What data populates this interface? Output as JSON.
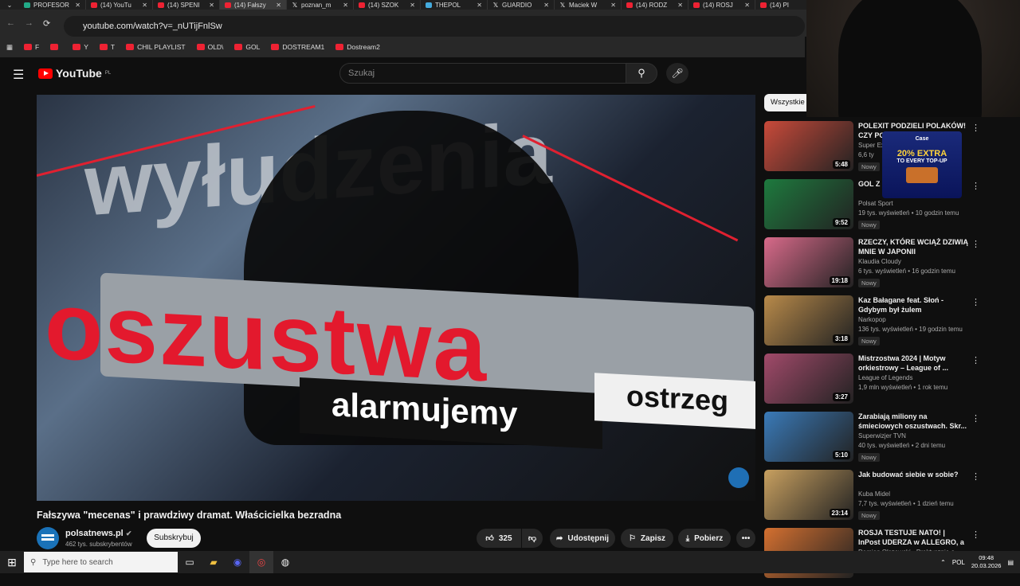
{
  "browser": {
    "tabs": [
      {
        "title": "PROFESOR",
        "icon": "green"
      },
      {
        "title": "(14) YouTu",
        "icon": "yt"
      },
      {
        "title": "(14) SPENI",
        "icon": "yt"
      },
      {
        "title": "(14) Fałszy",
        "icon": "yt",
        "active": true
      },
      {
        "title": "poznan_m",
        "icon": "x"
      },
      {
        "title": "(14) SZOK",
        "icon": "yt"
      },
      {
        "title": "THEPOL",
        "icon": "blue"
      },
      {
        "title": "GUARDIO",
        "icon": "x"
      },
      {
        "title": "Maciek W",
        "icon": "x"
      },
      {
        "title": "(14) RODZ",
        "icon": "yt"
      },
      {
        "title": "(14) ROSJ",
        "icon": "yt"
      },
      {
        "title": "(14) PI",
        "icon": "yt"
      }
    ],
    "url": "youtube.com/watch?v=_nUTijFnlSw",
    "bookmarks": [
      "F",
      "",
      "Y",
      "T",
      "CHIL PLAYLIST",
      "OLD\\",
      "GOL",
      "DOSTREAM1",
      "Dostream2"
    ]
  },
  "youtube": {
    "logo_text": "YouTube",
    "logo_region": "PL",
    "search_placeholder": "Szukaj",
    "chip_all": "Wszystkie"
  },
  "video": {
    "overlay_text_top": "wyłudzenia",
    "overlay_text_main": "oszustwa",
    "overlay_text_box1": "alarmujemy",
    "overlay_text_box2": "ostrzeg",
    "title": "Fałszywa \"mecenas\" i prawdziwy dramat. Właścicielka bezradna",
    "channel_name": "polsatnews.pl",
    "channel_subs": "462 tys. subskrybentów",
    "subscribe_label": "Subskrybuj",
    "likes": "325",
    "share_label": "Udostępnij",
    "save_label": "Zapisz",
    "download_label": "Pobierz"
  },
  "sidebar": {
    "videos": [
      {
        "title": "POLEXIT PODZIELI POLAKÓW! CZY PO",
        "channel": "Super Ex",
        "meta": "6,6 ty",
        "badge": "Nowy",
        "duration": "5:48",
        "thumb": "#c94a3a"
      },
      {
        "title": "GOL Z I MARZE",
        "channel": "Polsat Sport",
        "meta": "19 tys. wyświetleń • 10 godzin temu",
        "badge": "Nowy",
        "duration": "9:52",
        "thumb": "#1e7a3e"
      },
      {
        "title": "RZECZY, KTÓRE WCIĄŻ DZIWIĄ MNIE W JAPONII",
        "channel": "Klaudia Cloudy",
        "meta": "6 tys. wyświetleń • 16 godzin temu",
        "badge": "Nowy",
        "duration": "19:18",
        "thumb": "#d86a8a"
      },
      {
        "title": "Kaz Bałagane feat. Słoń - Gdybym był żulem",
        "channel": "Narkopop",
        "meta": "136 tys. wyświetleń • 19 godzin temu",
        "badge": "Nowy",
        "duration": "3:18",
        "thumb": "#b88a4a"
      },
      {
        "title": "Mistrzostwa 2024 | Motyw orkiestrowy – League of ...",
        "channel": "League of Legends",
        "meta": "1,9 mln wyświetleń • 1 rok temu",
        "badge": "",
        "duration": "3:27",
        "thumb": "#a14a6a"
      },
      {
        "title": "Zarabiają miliony na śmieciowych oszustwach. Skr...",
        "channel": "Superwizjer TVN",
        "meta": "40 tys. wyświetleń • 2 dni temu",
        "badge": "Nowy",
        "duration": "5:10",
        "thumb": "#3a7ab8"
      },
      {
        "title": "Jak budować siebie w sobie?",
        "channel": "Kuba Midel",
        "meta": "7,7 tys. wyświetleń • 1 dzień temu",
        "badge": "Nowy",
        "duration": "23:14",
        "thumb": "#c8a060"
      },
      {
        "title": "ROSJA TESTUJE NATO! | InPost UDERZA w ALLEGRO, a BAŁTY...",
        "channel": "Damian Olszewski - Praktycznie o pieniądzach",
        "meta": "",
        "badge": "",
        "duration": "",
        "thumb": "#d47030"
      }
    ]
  },
  "overlay_ad": {
    "brand": "Case",
    "headline": "20% EXTRA",
    "sub": "TO EVERY TOP-UP"
  },
  "taskbar": {
    "search_placeholder": "Type here to search",
    "lang": "POL",
    "time": "09:48",
    "date": "20.03.2026"
  }
}
